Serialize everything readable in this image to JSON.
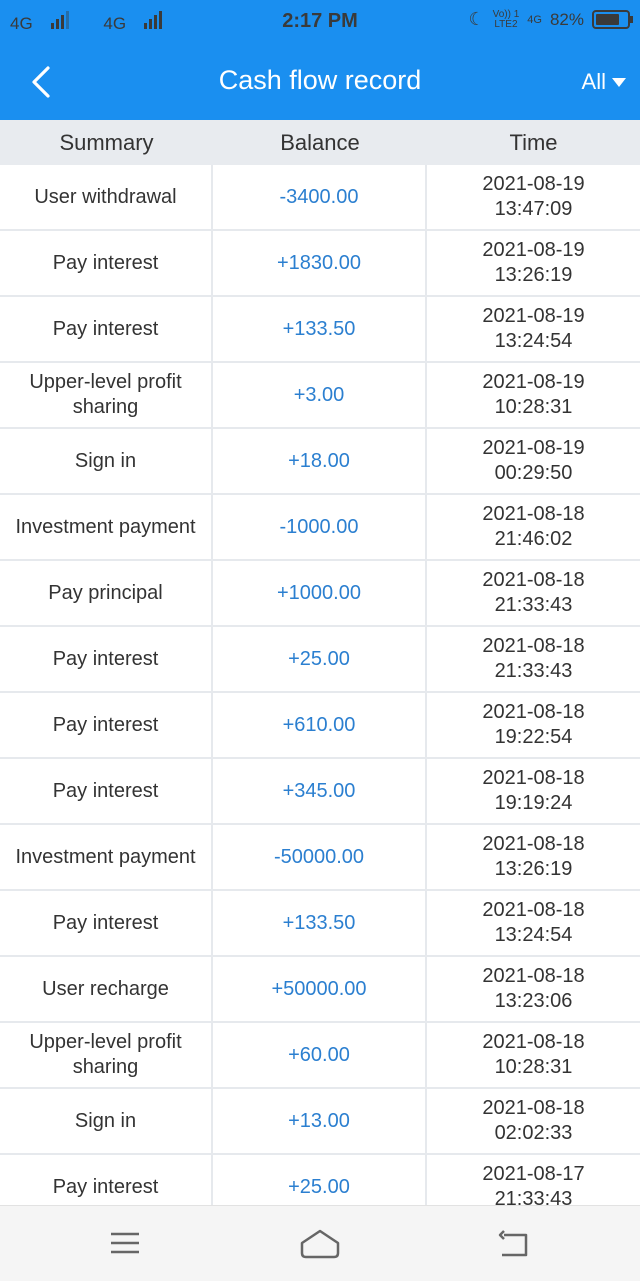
{
  "status_bar": {
    "network1": "4G",
    "network2": "4G",
    "time": "2:17 PM",
    "volte": "Vo)) 1",
    "lte": "LTE2",
    "net3": "4G",
    "battery": "82%",
    "battery_level": 0.82
  },
  "header": {
    "title": "Cash flow record",
    "filter_label": "All",
    "back_icon": "chevron-left-icon",
    "filter_icon": "caret-down-icon"
  },
  "columns": {
    "summary": "Summary",
    "balance": "Balance",
    "time": "Time"
  },
  "records": [
    {
      "summary": "User withdrawal",
      "balance": "-3400.00",
      "date": "2021-08-19",
      "clock": "13:47:09"
    },
    {
      "summary": "Pay interest",
      "balance": "+1830.00",
      "date": "2021-08-19",
      "clock": "13:26:19"
    },
    {
      "summary": "Pay interest",
      "balance": "+133.50",
      "date": "2021-08-19",
      "clock": "13:24:54"
    },
    {
      "summary": "Upper-level profit sharing",
      "balance": "+3.00",
      "date": "2021-08-19",
      "clock": "10:28:31"
    },
    {
      "summary": "Sign in",
      "balance": "+18.00",
      "date": "2021-08-19",
      "clock": "00:29:50"
    },
    {
      "summary": "Investment payment",
      "balance": "-1000.00",
      "date": "2021-08-18",
      "clock": "21:46:02"
    },
    {
      "summary": "Pay principal",
      "balance": "+1000.00",
      "date": "2021-08-18",
      "clock": "21:33:43"
    },
    {
      "summary": "Pay interest",
      "balance": "+25.00",
      "date": "2021-08-18",
      "clock": "21:33:43"
    },
    {
      "summary": "Pay interest",
      "balance": "+610.00",
      "date": "2021-08-18",
      "clock": "19:22:54"
    },
    {
      "summary": "Pay interest",
      "balance": "+345.00",
      "date": "2021-08-18",
      "clock": "19:19:24"
    },
    {
      "summary": "Investment payment",
      "balance": "-50000.00",
      "date": "2021-08-18",
      "clock": "13:26:19"
    },
    {
      "summary": "Pay interest",
      "balance": "+133.50",
      "date": "2021-08-18",
      "clock": "13:24:54"
    },
    {
      "summary": "User recharge",
      "balance": "+50000.00",
      "date": "2021-08-18",
      "clock": "13:23:06"
    },
    {
      "summary": "Upper-level profit sharing",
      "balance": "+60.00",
      "date": "2021-08-18",
      "clock": "10:28:31"
    },
    {
      "summary": "Sign in",
      "balance": "+13.00",
      "date": "2021-08-18",
      "clock": "02:02:33"
    },
    {
      "summary": "Pay interest",
      "balance": "+25.00",
      "date": "2021-08-17",
      "clock": "21:33:43"
    }
  ],
  "nav": {
    "menu_icon": "menu-icon",
    "home_icon": "home-icon",
    "back_icon": "back-icon"
  },
  "colors": {
    "accent": "#1a8ff0",
    "amount": "#2b7fd0"
  }
}
